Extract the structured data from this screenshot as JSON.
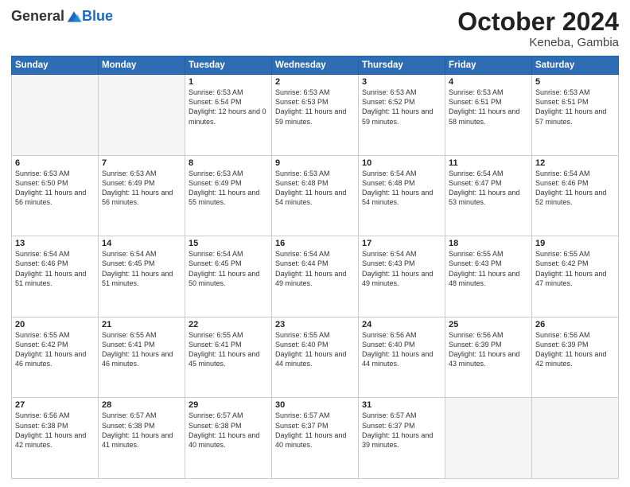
{
  "header": {
    "logo_general": "General",
    "logo_blue": "Blue",
    "month": "October 2024",
    "location": "Keneba, Gambia"
  },
  "days_of_week": [
    "Sunday",
    "Monday",
    "Tuesday",
    "Wednesday",
    "Thursday",
    "Friday",
    "Saturday"
  ],
  "weeks": [
    [
      {
        "day": "",
        "info": ""
      },
      {
        "day": "",
        "info": ""
      },
      {
        "day": "1",
        "info": "Sunrise: 6:53 AM\nSunset: 6:54 PM\nDaylight: 12 hours\nand 0 minutes."
      },
      {
        "day": "2",
        "info": "Sunrise: 6:53 AM\nSunset: 6:53 PM\nDaylight: 11 hours\nand 59 minutes."
      },
      {
        "day": "3",
        "info": "Sunrise: 6:53 AM\nSunset: 6:52 PM\nDaylight: 11 hours\nand 59 minutes."
      },
      {
        "day": "4",
        "info": "Sunrise: 6:53 AM\nSunset: 6:51 PM\nDaylight: 11 hours\nand 58 minutes."
      },
      {
        "day": "5",
        "info": "Sunrise: 6:53 AM\nSunset: 6:51 PM\nDaylight: 11 hours\nand 57 minutes."
      }
    ],
    [
      {
        "day": "6",
        "info": "Sunrise: 6:53 AM\nSunset: 6:50 PM\nDaylight: 11 hours\nand 56 minutes."
      },
      {
        "day": "7",
        "info": "Sunrise: 6:53 AM\nSunset: 6:49 PM\nDaylight: 11 hours\nand 56 minutes."
      },
      {
        "day": "8",
        "info": "Sunrise: 6:53 AM\nSunset: 6:49 PM\nDaylight: 11 hours\nand 55 minutes."
      },
      {
        "day": "9",
        "info": "Sunrise: 6:53 AM\nSunset: 6:48 PM\nDaylight: 11 hours\nand 54 minutes."
      },
      {
        "day": "10",
        "info": "Sunrise: 6:54 AM\nSunset: 6:48 PM\nDaylight: 11 hours\nand 54 minutes."
      },
      {
        "day": "11",
        "info": "Sunrise: 6:54 AM\nSunset: 6:47 PM\nDaylight: 11 hours\nand 53 minutes."
      },
      {
        "day": "12",
        "info": "Sunrise: 6:54 AM\nSunset: 6:46 PM\nDaylight: 11 hours\nand 52 minutes."
      }
    ],
    [
      {
        "day": "13",
        "info": "Sunrise: 6:54 AM\nSunset: 6:46 PM\nDaylight: 11 hours\nand 51 minutes."
      },
      {
        "day": "14",
        "info": "Sunrise: 6:54 AM\nSunset: 6:45 PM\nDaylight: 11 hours\nand 51 minutes."
      },
      {
        "day": "15",
        "info": "Sunrise: 6:54 AM\nSunset: 6:45 PM\nDaylight: 11 hours\nand 50 minutes."
      },
      {
        "day": "16",
        "info": "Sunrise: 6:54 AM\nSunset: 6:44 PM\nDaylight: 11 hours\nand 49 minutes."
      },
      {
        "day": "17",
        "info": "Sunrise: 6:54 AM\nSunset: 6:43 PM\nDaylight: 11 hours\nand 49 minutes."
      },
      {
        "day": "18",
        "info": "Sunrise: 6:55 AM\nSunset: 6:43 PM\nDaylight: 11 hours\nand 48 minutes."
      },
      {
        "day": "19",
        "info": "Sunrise: 6:55 AM\nSunset: 6:42 PM\nDaylight: 11 hours\nand 47 minutes."
      }
    ],
    [
      {
        "day": "20",
        "info": "Sunrise: 6:55 AM\nSunset: 6:42 PM\nDaylight: 11 hours\nand 46 minutes."
      },
      {
        "day": "21",
        "info": "Sunrise: 6:55 AM\nSunset: 6:41 PM\nDaylight: 11 hours\nand 46 minutes."
      },
      {
        "day": "22",
        "info": "Sunrise: 6:55 AM\nSunset: 6:41 PM\nDaylight: 11 hours\nand 45 minutes."
      },
      {
        "day": "23",
        "info": "Sunrise: 6:55 AM\nSunset: 6:40 PM\nDaylight: 11 hours\nand 44 minutes."
      },
      {
        "day": "24",
        "info": "Sunrise: 6:56 AM\nSunset: 6:40 PM\nDaylight: 11 hours\nand 44 minutes."
      },
      {
        "day": "25",
        "info": "Sunrise: 6:56 AM\nSunset: 6:39 PM\nDaylight: 11 hours\nand 43 minutes."
      },
      {
        "day": "26",
        "info": "Sunrise: 6:56 AM\nSunset: 6:39 PM\nDaylight: 11 hours\nand 42 minutes."
      }
    ],
    [
      {
        "day": "27",
        "info": "Sunrise: 6:56 AM\nSunset: 6:38 PM\nDaylight: 11 hours\nand 42 minutes."
      },
      {
        "day": "28",
        "info": "Sunrise: 6:57 AM\nSunset: 6:38 PM\nDaylight: 11 hours\nand 41 minutes."
      },
      {
        "day": "29",
        "info": "Sunrise: 6:57 AM\nSunset: 6:38 PM\nDaylight: 11 hours\nand 40 minutes."
      },
      {
        "day": "30",
        "info": "Sunrise: 6:57 AM\nSunset: 6:37 PM\nDaylight: 11 hours\nand 40 minutes."
      },
      {
        "day": "31",
        "info": "Sunrise: 6:57 AM\nSunset: 6:37 PM\nDaylight: 11 hours\nand 39 minutes."
      },
      {
        "day": "",
        "info": ""
      },
      {
        "day": "",
        "info": ""
      }
    ]
  ]
}
